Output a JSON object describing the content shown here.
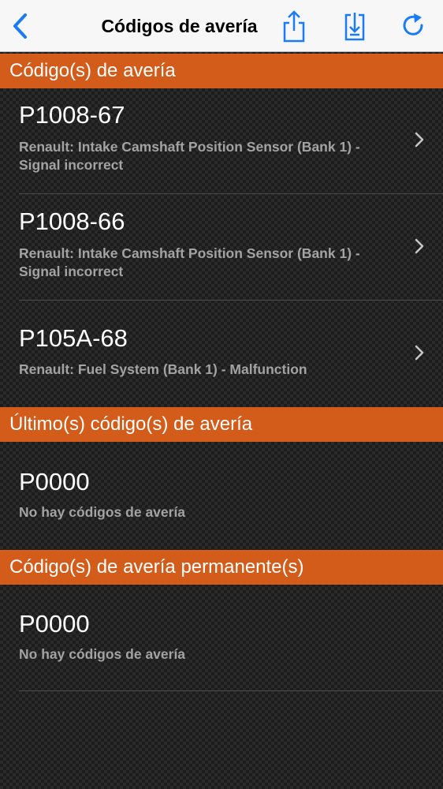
{
  "nav": {
    "title": "Códigos de avería",
    "accent_color": "#1a7cf5"
  },
  "sections": [
    {
      "header": "Código(s) de avería",
      "rows": [
        {
          "code": "P1008-67",
          "description": "Renault: Intake Camshaft Position Sensor (Bank 1) - Signal incorrect"
        },
        {
          "code": "P1008-66",
          "description": "Renault: Intake Camshaft Position Sensor (Bank 1) - Signal incorrect"
        },
        {
          "code": "P105A-68",
          "description": "Renault: Fuel System (Bank 1) - Malfunction"
        }
      ]
    },
    {
      "header": "Último(s) código(s) de avería",
      "rows": [
        {
          "code": "P0000",
          "description": "No hay códigos de avería"
        }
      ]
    },
    {
      "header": "Código(s) de avería permanente(s)",
      "rows": [
        {
          "code": "P0000",
          "description": "No hay códigos de avería"
        }
      ]
    }
  ],
  "colors": {
    "section_header_bg": "#d35c1a",
    "code_text": "#ffffff",
    "description_text": "#a3a3a3"
  }
}
